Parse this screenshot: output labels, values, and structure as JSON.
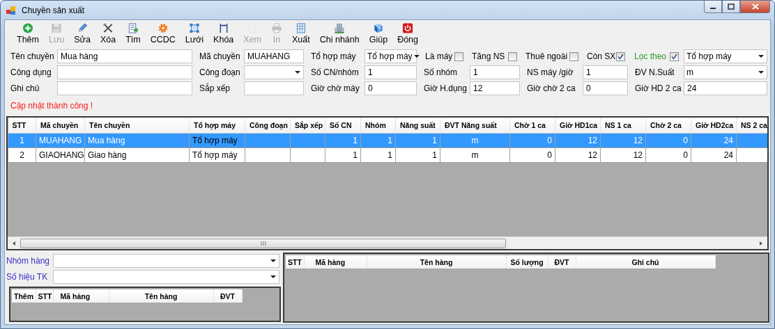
{
  "window": {
    "title": "Chuyền sản xuất"
  },
  "toolbar": [
    {
      "label": "Thêm",
      "disabled": false
    },
    {
      "label": "Lưu",
      "disabled": true
    },
    {
      "label": "Sửa",
      "disabled": false
    },
    {
      "label": "Xóa",
      "disabled": false
    },
    {
      "label": "Tìm",
      "disabled": false
    },
    {
      "label": "CCDC",
      "disabled": false
    },
    {
      "label": "Lưới",
      "disabled": false
    },
    {
      "label": "Khóa",
      "disabled": false
    },
    {
      "label": "Xem",
      "disabled": true
    },
    {
      "label": "In",
      "disabled": true
    },
    {
      "label": "Xuất",
      "disabled": false
    },
    {
      "label": "Chi nhánh",
      "disabled": false
    },
    {
      "label": "Giúp",
      "disabled": false
    },
    {
      "label": "Đóng",
      "disabled": false
    }
  ],
  "form": {
    "fields": [
      {
        "kind": "text",
        "label": "Tên chuyền",
        "value": "Mua hàng"
      },
      {
        "kind": "text",
        "label": "Mã chuyền",
        "value": "MUAHANG"
      },
      {
        "kind": "select",
        "label": "Tổ hợp máy",
        "value": "Tổ hợp máy"
      },
      {
        "kind": "check",
        "label": "Là máy",
        "checked": false
      },
      {
        "kind": "check",
        "label": "Tăng NS",
        "checked": false
      },
      {
        "kind": "check",
        "label": "Thuê ngoài",
        "checked": false
      },
      {
        "kind": "check",
        "label": "Còn SX",
        "checked": true
      },
      {
        "kind": "filter",
        "label": "Lọc theo",
        "checked": true
      },
      {
        "kind": "select",
        "value": "Tổ hợp máy"
      },
      {
        "kind": "text",
        "label": "Công dụng"
      },
      {
        "kind": "select",
        "label": "Công đoạn"
      },
      {
        "kind": "text",
        "label": "Số CN/nhóm",
        "value": "1"
      },
      {
        "kind": "text",
        "label": "Số nhóm",
        "value": "1"
      },
      {
        "kind": "text",
        "label": "NS máy /giờ",
        "value": "1"
      },
      {
        "kind": "select",
        "label": "ĐV N.Suất",
        "value": "m"
      },
      {
        "kind": "text",
        "label": "Ghi chú"
      },
      {
        "kind": "text",
        "label": "Sắp xếp"
      },
      {
        "kind": "text",
        "label": "Giờ chờ máy",
        "value": "0"
      },
      {
        "kind": "text",
        "label": "Giờ H.dụng",
        "value": "12"
      },
      {
        "kind": "text",
        "label": "Giờ chờ 2 ca",
        "value": "0"
      },
      {
        "kind": "text",
        "label": "Giờ HD 2 ca",
        "value": "24"
      }
    ],
    "message": "Cập nhật thành công !"
  },
  "grid": {
    "columns": [
      "STT",
      "Mã chuyền",
      "Tên chuyền",
      "Tổ hợp máy",
      "Công đoạn",
      "Sắp xếp",
      "Số CN",
      "Nhóm",
      "Năng suất",
      "ĐVT Năng suất",
      "Chờ 1 ca",
      "Giờ HD1ca",
      "NS 1 ca",
      "Chờ 2 ca",
      "Giờ HD2ca",
      "NS 2 ca"
    ],
    "rows": [
      {
        "selected": true,
        "cells": [
          "1",
          "MUAHANG",
          "Mua hàng",
          "Tổ hợp máy",
          null,
          null,
          "1",
          "1",
          "1",
          "m",
          "0",
          "12",
          "12",
          "0",
          "24",
          null
        ]
      },
      {
        "selected": false,
        "cells": [
          "2",
          "GIAOHANG",
          "Giao hàng",
          "Tổ hợp máy",
          null,
          null,
          "1",
          "1",
          "1",
          "m",
          "0",
          "12",
          "12",
          "0",
          "24",
          null
        ]
      }
    ]
  },
  "bottom": {
    "filters": [
      {
        "label": "Nhóm hàng"
      },
      {
        "label": "Số hiệu TK"
      }
    ],
    "items_grid": {
      "columns": [
        "Thêm",
        "STT",
        "Mã hàng",
        "Tên hàng",
        "ĐVT"
      ]
    },
    "detail_grid": {
      "columns": [
        "STT",
        "Mã hàng",
        "Tên hàng",
        "Số lượng",
        "ĐVT",
        "Ghi chú"
      ]
    }
  }
}
